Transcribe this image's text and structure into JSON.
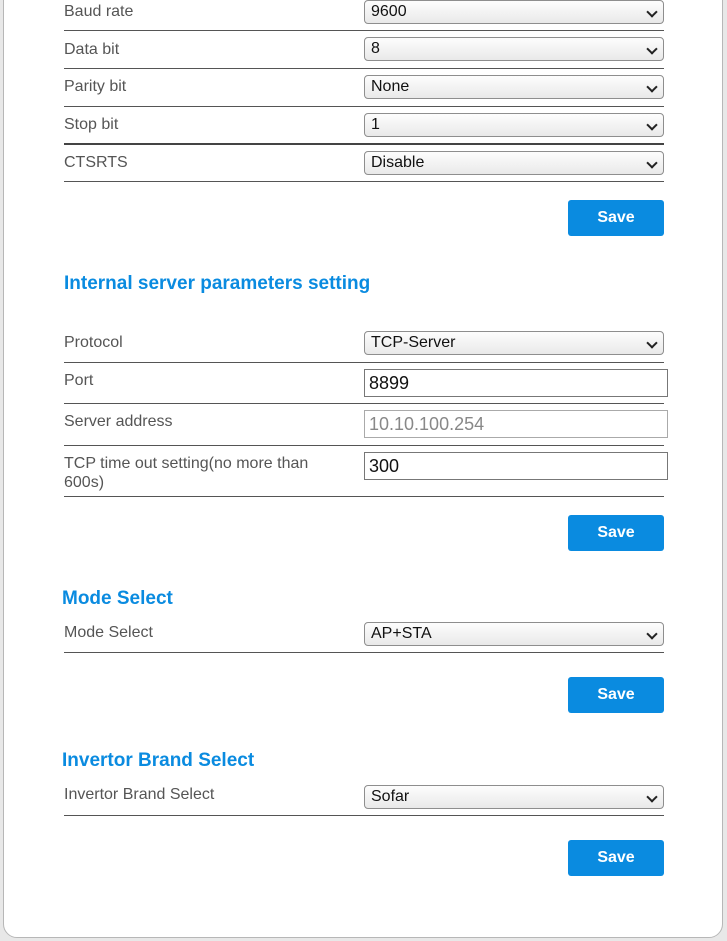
{
  "serial": {
    "rows": [
      {
        "label": "Baud rate",
        "value": "9600"
      },
      {
        "label": "Data bit",
        "value": "8"
      },
      {
        "label": "Parity bit",
        "value": "None"
      },
      {
        "label": "Stop bit",
        "value": "1"
      },
      {
        "label": "CTSRTS",
        "value": "Disable"
      }
    ],
    "save_label": "Save"
  },
  "internal_server": {
    "title": "Internal server parameters setting",
    "protocol": {
      "label": "Protocol",
      "value": "TCP-Server"
    },
    "port": {
      "label": "Port",
      "value": "8899"
    },
    "server_address": {
      "label": "Server address",
      "value": "10.10.100.254"
    },
    "timeout": {
      "label_line1": "TCP time out setting(no more than",
      "label_line2": "600s)",
      "value": "300"
    },
    "save_label": "Save"
  },
  "mode_select": {
    "title": "Mode Select",
    "label": "Mode Select",
    "value": "AP+STA",
    "save_label": "Save"
  },
  "invertor_brand": {
    "title": "Invertor Brand Select",
    "label": "Invertor Brand Select",
    "value": "Sofar",
    "save_label": "Save"
  },
  "colors": {
    "accent": "#0a8be0",
    "button_text": "#ffffff",
    "label_text": "#555555"
  }
}
